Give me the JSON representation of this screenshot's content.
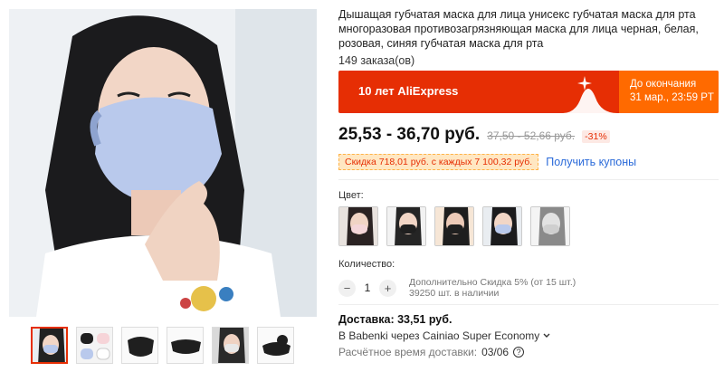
{
  "product": {
    "title": "Дышащая губчатая маска для лица унисекс губчатая маска для рта многоразовая противозагрязняющая маска для лица черная, белая, розовая, синяя губчатая маска для рта",
    "orders": "149 заказа(ов)"
  },
  "promo": {
    "title": "10 лет AliExpress",
    "countdown_line1": "До окончания",
    "countdown_line2": "31 мар., 23:59 PT"
  },
  "price": {
    "current": "25,53 - 36,70 руб.",
    "old": "37,50 - 52,66 руб.",
    "discount": "-31%"
  },
  "coupon": {
    "tag": "Скидка 718,01 руб. с каждых 7 100,32 руб.",
    "link": "Получить купоны"
  },
  "color": {
    "label": "Цвет:",
    "options": [
      "белая",
      "синяя",
      "черная",
      "синяя",
      "серая"
    ]
  },
  "quantity": {
    "label": "Количество:",
    "value": "1",
    "minus": "−",
    "plus": "+",
    "note_line1": "Дополнительно Скидка 5% (от 15 шт.)",
    "note_line2": "39250 шт. в наличии"
  },
  "shipping": {
    "title": "Доставка: 33,51 руб.",
    "method": "В Babenki через Cainiao Super Economy",
    "eta_label": "Расчётное время доставки:",
    "eta_value": "03/06",
    "help": "?"
  },
  "colors": {
    "accent": "#e62e04",
    "accent_orange": "#ff6a00",
    "link": "#2a6ad9",
    "mask_blue": "#b9c9ec",
    "mask_black": "#1f1f1f"
  }
}
